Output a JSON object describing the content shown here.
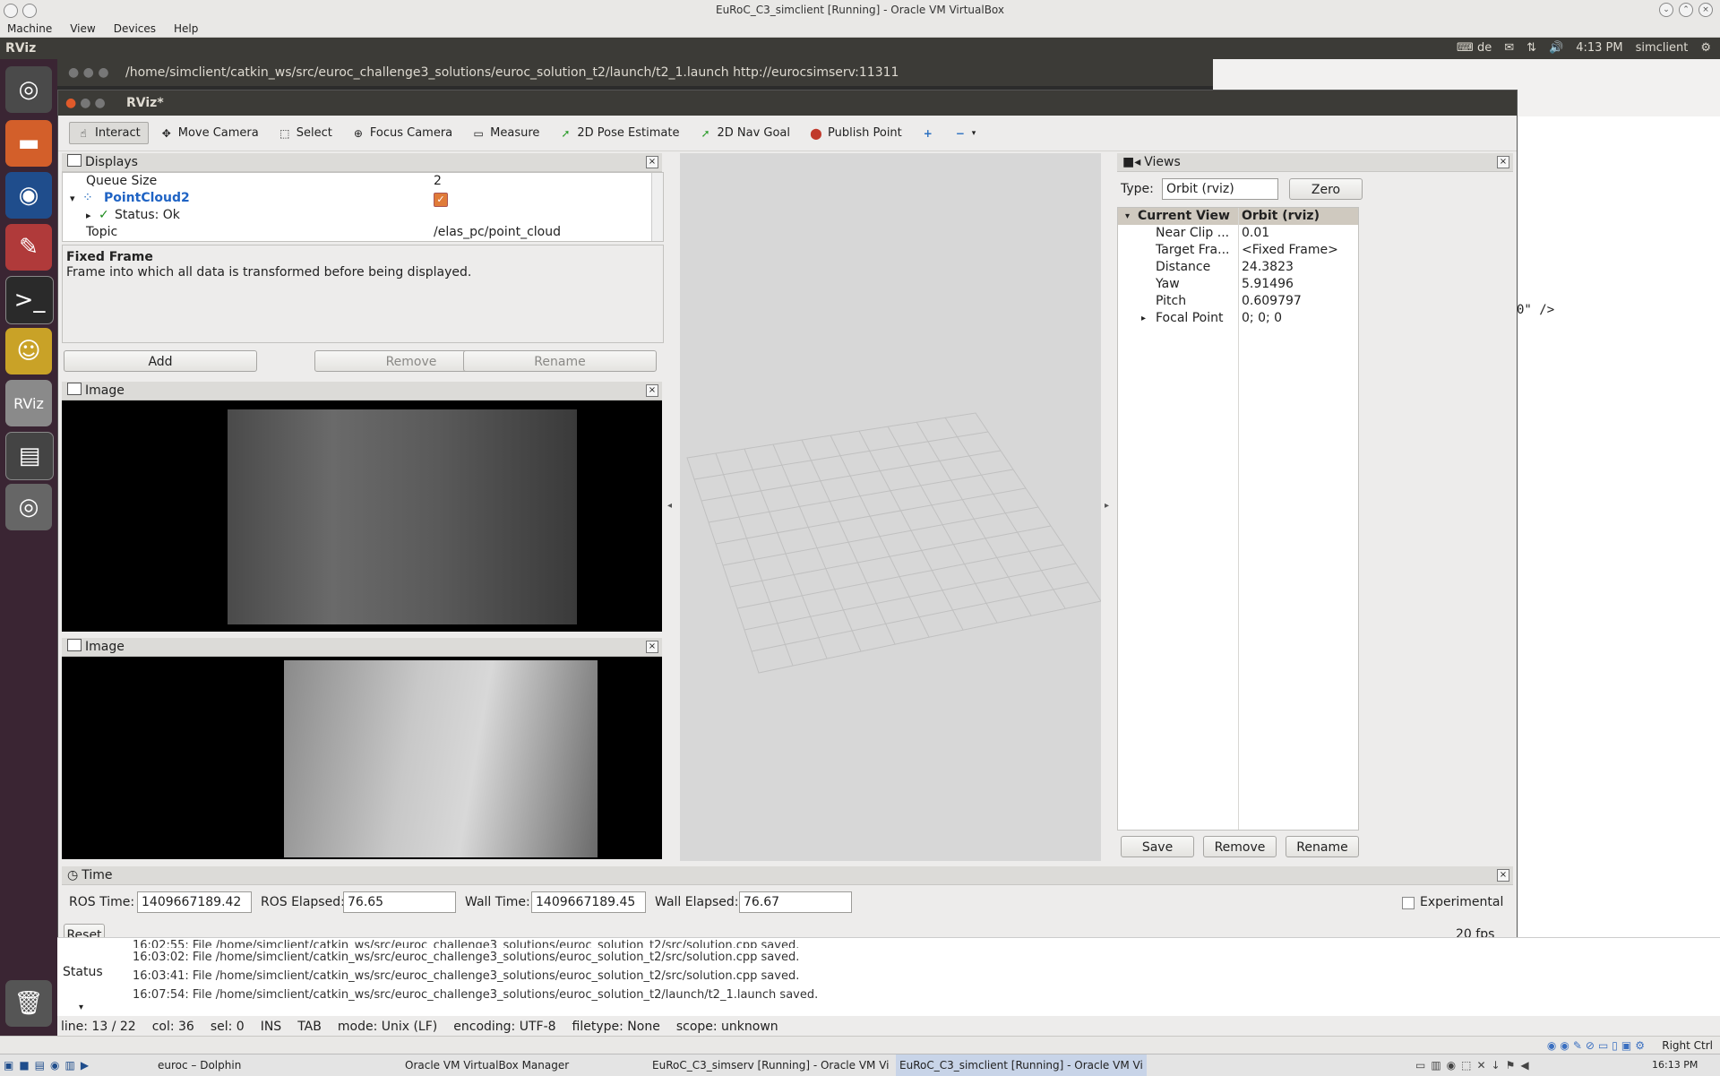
{
  "vbox": {
    "title": "EuRoC_C3_simclient [Running] - Oracle VM VirtualBox",
    "menu": [
      "Machine",
      "View",
      "Devices",
      "Help"
    ],
    "host_key": "Right Ctrl"
  },
  "ubuntu_panel": {
    "app": "RViz",
    "keyboard": "de",
    "time": "4:13 PM",
    "user": "simclient"
  },
  "bg_window": {
    "title": "/home/simclient/catkin_ws/src/euroc_challenge3_solutions/euroc_solution_t2/launch/t2_1.launch http://eurocsimserv:11311",
    "snippet": "0\" />"
  },
  "rviz": {
    "title": "RViz*",
    "tools": [
      "Interact",
      "Move Camera",
      "Select",
      "Focus Camera",
      "Measure",
      "2D Pose Estimate",
      "2D Nav Goal",
      "Publish Point"
    ],
    "displays": {
      "header": "Displays",
      "rows": [
        {
          "name": "Queue Size",
          "value": "2"
        },
        {
          "name": "PointCloud2",
          "value": ""
        },
        {
          "name": "Status: Ok",
          "value": ""
        },
        {
          "name": "Topic",
          "value": "/elas_pc/point_cloud"
        }
      ],
      "help_title": "Fixed Frame",
      "help_text": "Frame into which all data is transformed before being displayed.",
      "add": "Add",
      "remove": "Remove",
      "rename": "Rename"
    },
    "image1": {
      "header": "Image"
    },
    "image2": {
      "header": "Image"
    },
    "views": {
      "header": "Views",
      "type_label": "Type:",
      "type_value": "Orbit (rviz)",
      "zero": "Zero",
      "col1": "Current View",
      "col2": "Orbit (rviz)",
      "props": [
        {
          "name": "Near Clip ...",
          "value": "0.01"
        },
        {
          "name": "Target Fra...",
          "value": "<Fixed Frame>"
        },
        {
          "name": "Distance",
          "value": "24.3823"
        },
        {
          "name": "Yaw",
          "value": "5.91496"
        },
        {
          "name": "Pitch",
          "value": "0.609797"
        },
        {
          "name": "Focal Point",
          "value": "0; 0; 0"
        }
      ],
      "save": "Save",
      "remove": "Remove",
      "rename": "Rename"
    },
    "time": {
      "header": "Time",
      "ros_time_label": "ROS Time:",
      "ros_time": "1409667189.42",
      "ros_elapsed_label": "ROS Elapsed:",
      "ros_elapsed": "76.65",
      "wall_time_label": "Wall Time:",
      "wall_time": "1409667189.45",
      "wall_elapsed_label": "Wall Elapsed:",
      "wall_elapsed": "76.67",
      "experimental": "Experimental",
      "reset": "Reset",
      "fps": "20 fps"
    }
  },
  "status": {
    "label": "Status",
    "lines": [
      "16:02:55: File /home/simclient/catkin_ws/src/euroc_challenge3_solutions/euroc_solution_t2/src/solution.cpp saved.",
      "16:03:02: File /home/simclient/catkin_ws/src/euroc_challenge3_solutions/euroc_solution_t2/src/solution.cpp saved.",
      "16:03:41: File /home/simclient/catkin_ws/src/euroc_challenge3_solutions/euroc_solution_t2/src/solution.cpp saved.",
      "16:07:54: File /home/simclient/catkin_ws/src/euroc_challenge3_solutions/euroc_solution_t2/launch/t2_1.launch saved."
    ]
  },
  "editor_status": {
    "line": "line: 13 / 22",
    "col": "col: 36",
    "sel": "sel: 0",
    "ins": "INS",
    "tab": "TAB",
    "mode": "mode: Unix (LF)",
    "encoding": "encoding: UTF-8",
    "filetype": "filetype: None",
    "scope": "scope: unknown"
  },
  "taskbar": {
    "items": [
      "euroc – Dolphin",
      "Oracle VM VirtualBox Manager",
      "EuRoC_C3_simserv [Running] - Oracle VM Vi",
      "EuRoC_C3_simclient [Running] - Oracle VM Vi"
    ],
    "clock": "16:13 PM"
  }
}
